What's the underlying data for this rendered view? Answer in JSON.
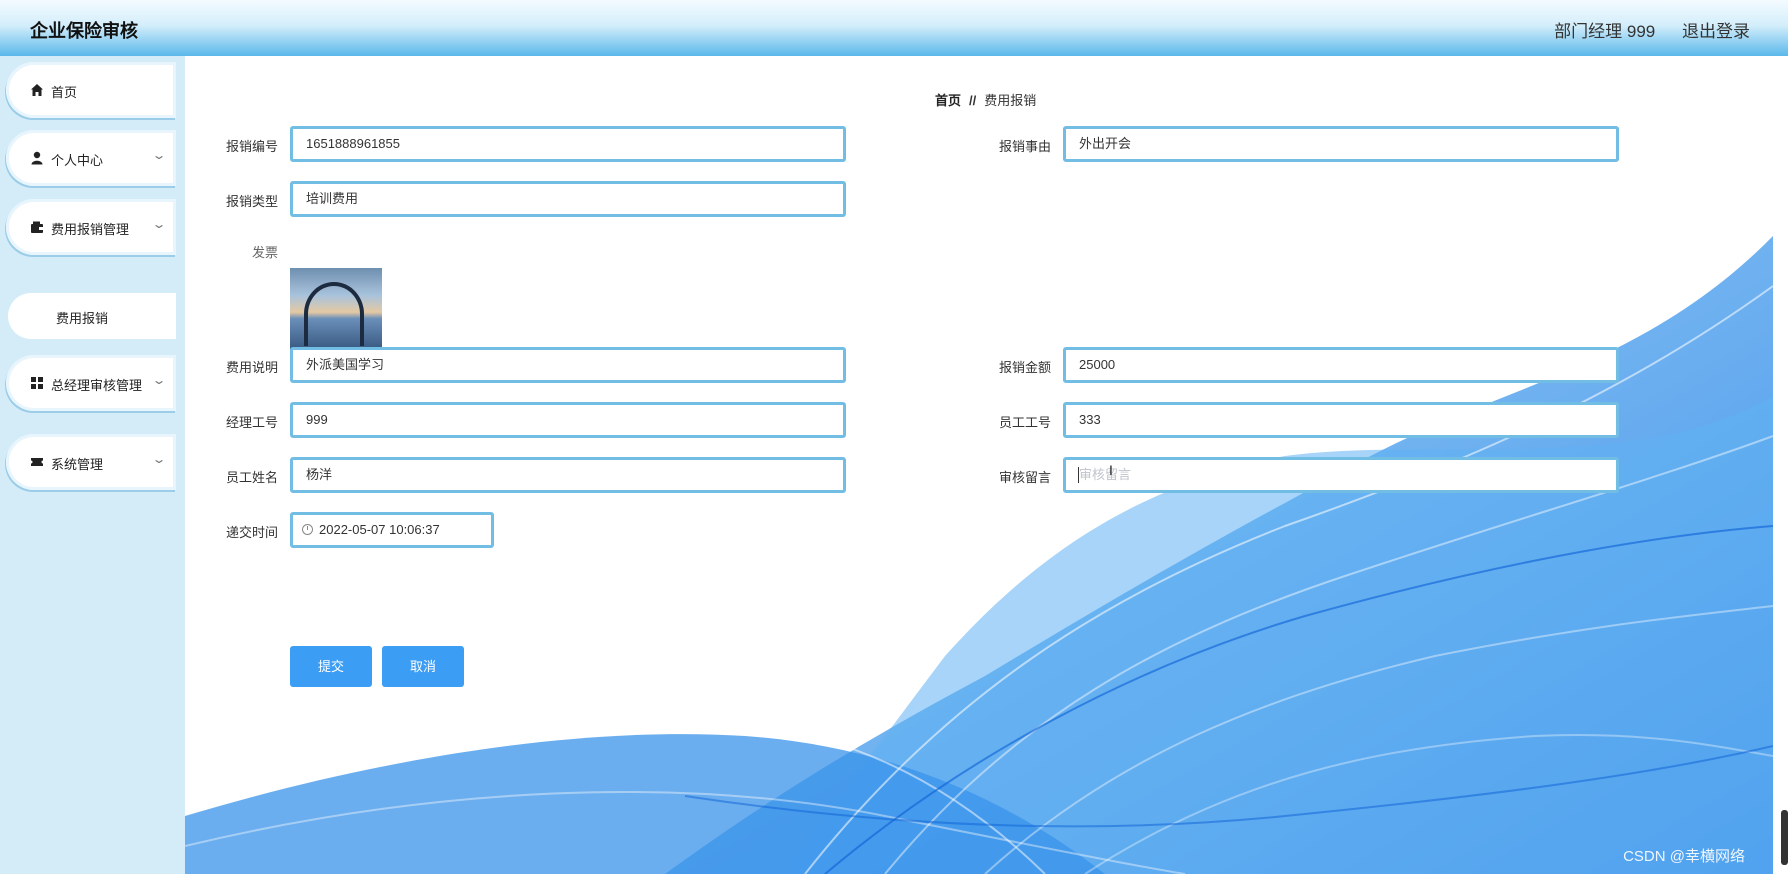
{
  "header": {
    "title": "企业保险审核",
    "user": "部门经理 999",
    "logout": "退出登录"
  },
  "sidebar": {
    "items": [
      {
        "label": "首页",
        "icon": "home-icon"
      },
      {
        "label": "个人中心",
        "icon": "user-icon"
      },
      {
        "label": "费用报销管理",
        "icon": "wallet-icon"
      },
      {
        "label": "总经理审核管理",
        "icon": "grid-icon"
      },
      {
        "label": "系统管理",
        "icon": "ticket-icon"
      }
    ],
    "sub_item": "费用报销"
  },
  "breadcrumb": {
    "home": "首页",
    "separator": "//",
    "current": "费用报销"
  },
  "form": {
    "reimb_no": {
      "label": "报销编号",
      "value": "1651888961855"
    },
    "reason": {
      "label": "报销事由",
      "value": "外出开会"
    },
    "type": {
      "label": "报销类型",
      "value": "培训费用"
    },
    "invoice": {
      "label": "发票"
    },
    "description": {
      "label": "费用说明",
      "value": "外派美国学习"
    },
    "amount": {
      "label": "报销金额",
      "value": "25000"
    },
    "manager_id": {
      "label": "经理工号",
      "value": "999"
    },
    "employee_id": {
      "label": "员工工号",
      "value": "333"
    },
    "employee_name": {
      "label": "员工姓名",
      "value": "杨洋"
    },
    "review_comment": {
      "label": "审核留言",
      "placeholder": "审核留言"
    },
    "submit_time": {
      "label": "递交时间",
      "value": "2022-05-07 10:06:37"
    },
    "submit_label": "提交",
    "cancel_label": "取消"
  },
  "watermark": "CSDN @幸横网络",
  "colors": {
    "accent": "#3c9df5",
    "input_border": "#72bde3",
    "sidebar_bg": "#d4ecf8"
  }
}
